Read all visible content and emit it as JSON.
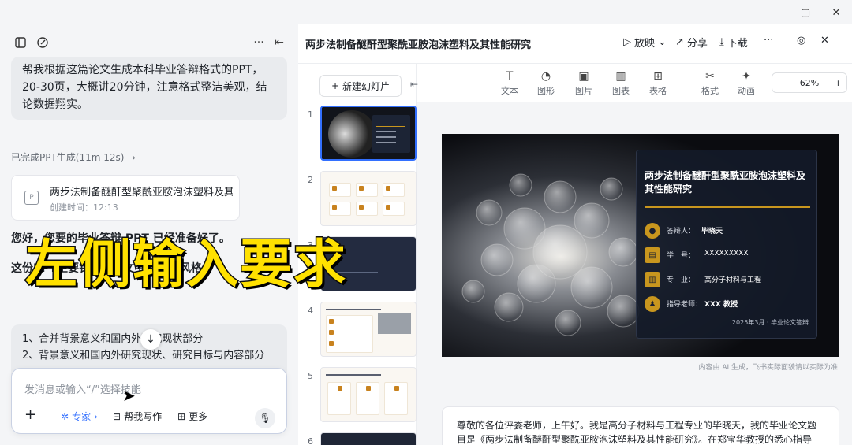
{
  "window": {
    "minimize": "—",
    "maximize": "▢",
    "close": "✕"
  },
  "chat": {
    "user_message": "帮我根据这篇论文生成本科毕业答辩格式的PPT，20-30页，大概讲20分钟，注意格式整洁美观，结论数据翔实。",
    "status": "已完成PPT生成(11m 12s)",
    "status_chevron": "›",
    "file_card": {
      "icon": "P",
      "title": "两步法制备醚酐型聚酰亚胺泡沫塑料及其...",
      "time": "创建时间：12:13"
    },
    "reply_1": "您好，您要的毕业答辩 PPT 已经准备好了。",
    "reply_2": "这份PPT主要针对您论文中...科技风格,",
    "overlay": "左侧输入要求",
    "list": [
      "1、合并背景意义和国内外研究现状部分",
      "2、背景意义和国内外研究现状、研究目标与内容部分"
    ],
    "scroll_down": "↓",
    "input_placeholder": "发消息或输入“/”选择技能",
    "tools": {
      "add": "+",
      "expert": "专家",
      "write": "帮我写作",
      "more": "更多"
    }
  },
  "doc": {
    "title": "两步法制备醚酐型聚酰亚胺泡沫塑料及其性能研究",
    "actions": {
      "play": "放映",
      "share": "分享",
      "download": "下载",
      "more": "···"
    }
  },
  "slides_panel": {
    "new_slide": "新建幻灯片",
    "numbers": [
      "1",
      "2",
      "3",
      "4",
      "5",
      "6"
    ]
  },
  "toolbar": {
    "text": "文本",
    "shape": "图形",
    "image": "图片",
    "chart": "图表",
    "table": "表格",
    "format": "格式",
    "animation": "动画",
    "zoom": "62%",
    "zoom_minus": "−",
    "zoom_plus": "+"
  },
  "slide": {
    "title": "两步法制备醚酐型聚酰亚胺泡沫塑料及其性能研究",
    "rows": [
      {
        "label": "答辩人：",
        "value": "毕晓天"
      },
      {
        "label": "学　号：",
        "value": "XXXXXXXXX"
      },
      {
        "label": "专　业：",
        "value": "高分子材料与工程"
      },
      {
        "label": "指导老师：",
        "value": "XXX 教授"
      }
    ],
    "footer": "2025年3月 · 毕业论文答辩"
  },
  "ai_note": "内容由 AI 生成，飞书实际面貌请以实际为准",
  "notes": "尊敬的各位评委老师，上午好。我是高分子材料与工程专业的毕晓天，我的毕业论文题目是《两步法制备醚酐型聚酰亚胺泡沫塑料及其性能研究》。在郑宝华教授的悉心指导"
}
